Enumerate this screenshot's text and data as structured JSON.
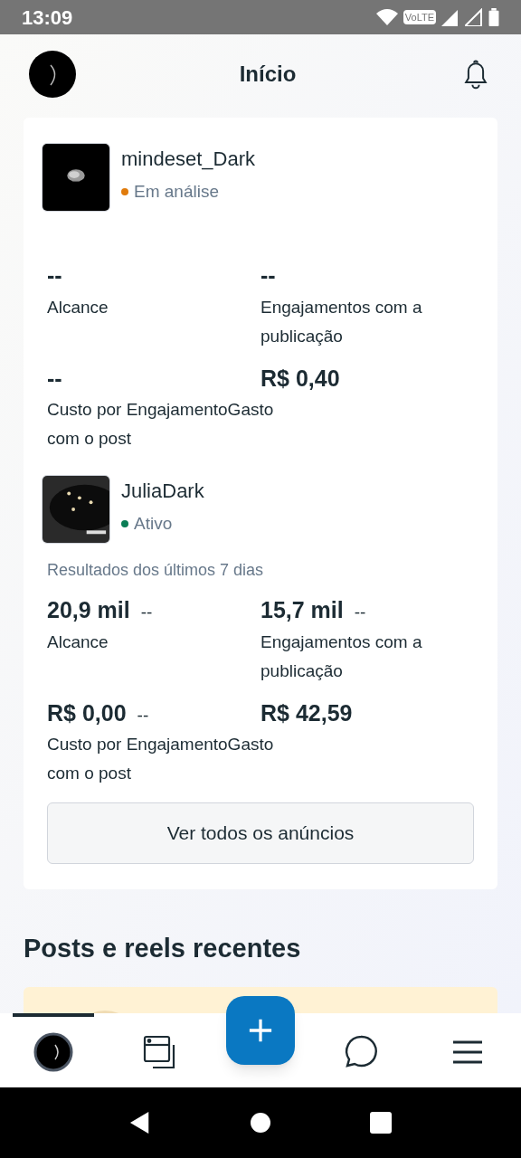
{
  "status_bar": {
    "time": "13:09",
    "network": "VoLTE"
  },
  "header": {
    "title": "Início"
  },
  "ads": [
    {
      "name": "mindeset_Dark",
      "status": "Em análise",
      "color": "#e07b0c",
      "metric_rows": [
        {
          "cells": [
            {
              "value": "--"
            },
            {
              "value": "--"
            }
          ],
          "labels": [
            "Alcance",
            "Engajamentos com a publicação"
          ]
        },
        {
          "cells": [
            {
              "value": "--"
            },
            {
              "value": "R$ 0,40"
            }
          ],
          "labels": [
            "Custo por EngajamentoGasto com o post"
          ]
        }
      ]
    },
    {
      "name": "JuliaDark",
      "status": "Ativo",
      "color": "#0a7d55",
      "period": "Resultados dos últimos 7 dias",
      "metric_rows": [
        {
          "cells": [
            {
              "value": "20,9 mil",
              "delta": "--"
            },
            {
              "value": "15,7 mil",
              "delta": "--"
            }
          ],
          "labels": [
            "Alcance",
            "Engajamentos com a publicação"
          ]
        },
        {
          "cells": [
            {
              "value": "R$ 0,00",
              "delta": "--"
            },
            {
              "value": "R$ 42,59"
            }
          ],
          "labels": [
            "Custo por EngajamentoGasto com o post"
          ]
        }
      ]
    }
  ],
  "all_ads_button": "Ver todos os anúncios",
  "section_title": "Posts e reels recentes",
  "nav": [
    {
      "kind": "profile",
      "selected": true
    },
    {
      "kind": "pages",
      "selected": false
    },
    {
      "kind": "create",
      "selected": false
    },
    {
      "kind": "messages",
      "selected": false
    },
    {
      "kind": "menu",
      "selected": false
    }
  ]
}
